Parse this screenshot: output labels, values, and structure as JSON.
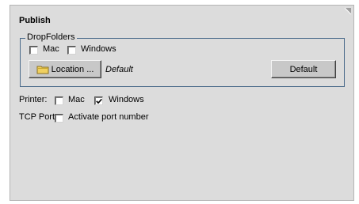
{
  "panel": {
    "title": "Publish",
    "corner_icon": "resize-corner-icon"
  },
  "dropfolders": {
    "legend": "DropFolders",
    "mac_label": "Mac",
    "mac_checked": false,
    "windows_label": "Windows",
    "windows_checked": false,
    "location_button_label": "Location ...",
    "location_button_icon": "folder-icon",
    "location_value": "Default",
    "default_button_label": "Default"
  },
  "printer": {
    "label": "Printer:",
    "mac_label": "Mac",
    "mac_checked": false,
    "windows_label": "Windows",
    "windows_checked": true
  },
  "tcp": {
    "label": "TCP Port:",
    "activate_label": "Activate port number",
    "activate_checked": false
  },
  "colors": {
    "panel_bg": "#dcdcdc",
    "group_border": "#4a6a8a",
    "folder_yellow": "#f0d060"
  }
}
